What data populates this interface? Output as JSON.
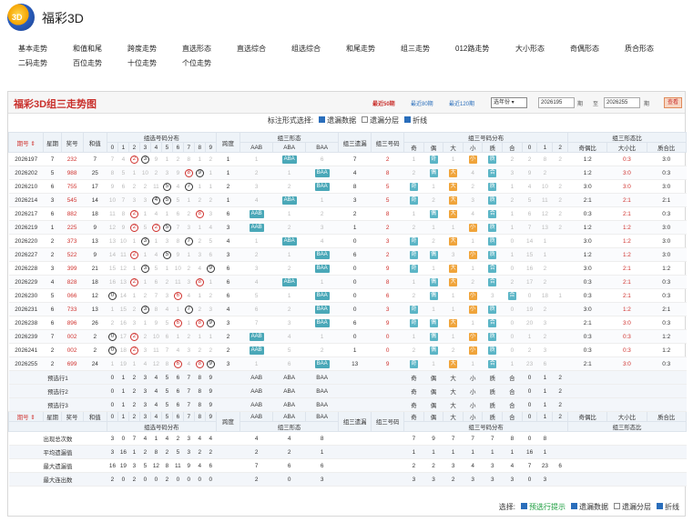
{
  "app": {
    "logo_text": "3D",
    "title": "福彩3D"
  },
  "nav": [
    "基本走势",
    "和值和尾",
    "跨度走势",
    "直选形态",
    "直选综合",
    "组选综合",
    "和尾走势",
    "组三走势",
    "012路走势",
    "大小形态",
    "奇偶形态",
    "质合形态",
    "二码走势",
    "百位走势",
    "十位走势",
    "个位走势"
  ],
  "panel": {
    "title": "福彩3D组三走势图",
    "periods": [
      "最近50期",
      "最近80期",
      "最近120期"
    ],
    "year_select": "选年份",
    "from": "2026195",
    "to_label": "至",
    "to": "2026255",
    "qi": "期",
    "query": "查看",
    "period_label": "期"
  },
  "options": {
    "label": "标注形式选择:",
    "items": [
      {
        "label": "遗漏数据",
        "checked": true
      },
      {
        "label": "遗漏分层",
        "checked": false
      },
      {
        "label": "折线",
        "checked": true
      }
    ]
  },
  "head1": [
    "期号",
    "星期",
    "奖号",
    "和值",
    "组选号码分布",
    "跨度",
    "组三形态",
    "组三遗漏",
    "组三号码",
    "组三号码分布",
    "组三形态比"
  ],
  "head2": [
    "0",
    "1",
    "2",
    "3",
    "4",
    "5",
    "6",
    "7",
    "8",
    "9",
    "AAB",
    "ABA",
    "BAA",
    "奇",
    "偶",
    "大",
    "小",
    "质",
    "合",
    "0",
    "1",
    "2",
    "奇偶比",
    "大小比",
    "质合比"
  ],
  "rows": [
    {
      "q": "2026197",
      "w": "7",
      "n": "232",
      "s": "7",
      "d": [
        "7",
        "4",
        "②",
        "③",
        "9",
        "1",
        "2",
        "8",
        "1",
        "2"
      ],
      "sp": "1",
      "f": [
        "1",
        "ABA",
        "6"
      ],
      "yl": "7",
      "h": "2",
      "g": [
        "1",
        "奇",
        "1",
        "小",
        "质",
        "2",
        "2",
        "8",
        "2"
      ],
      "r": [
        "1:2",
        "0:3",
        "3:0"
      ]
    },
    {
      "q": "2026202",
      "w": "5",
      "n": "988",
      "s": "25",
      "d": [
        "8",
        "5",
        "1",
        "10",
        "2",
        "3",
        "9",
        "⑧",
        "⑨",
        "1"
      ],
      "sp": "1",
      "f": [
        "2",
        "1",
        "BAA"
      ],
      "yl": "4",
      "h": "8",
      "g": [
        "2",
        "偶",
        "大",
        "4",
        "合",
        "3",
        "9",
        "2"
      ],
      "r": [
        "1:2",
        "3:0",
        "0:3"
      ]
    },
    {
      "q": "2026210",
      "w": "6",
      "n": "755",
      "s": "17",
      "d": [
        "9",
        "6",
        "2",
        "2",
        "11",
        "⑤",
        "4",
        "⑦",
        "1",
        "1"
      ],
      "sp": "2",
      "f": [
        "3",
        "2",
        "BAA"
      ],
      "yl": "8",
      "h": "5",
      "g": [
        "奇",
        "1",
        "大",
        "2",
        "质",
        "1",
        "4",
        "10",
        "2"
      ],
      "r": [
        "3:0",
        "3:0",
        "3:0"
      ]
    },
    {
      "q": "2026214",
      "w": "3",
      "n": "545",
      "s": "14",
      "d": [
        "10",
        "7",
        "3",
        "3",
        "④",
        "⑤",
        "5",
        "1",
        "2",
        "2"
      ],
      "sp": "1",
      "f": [
        "4",
        "ABA",
        "1"
      ],
      "yl": "3",
      "h": "5",
      "g": [
        "奇",
        "2",
        "大",
        "3",
        "质",
        "2",
        "5",
        "11",
        "2"
      ],
      "r": [
        "2:1",
        "2:1",
        "2:1"
      ]
    },
    {
      "q": "2026217",
      "w": "6",
      "n": "882",
      "s": "18",
      "d": [
        "11",
        "8",
        "②",
        "1",
        "4",
        "1",
        "6",
        "2",
        "⑧",
        "3"
      ],
      "sp": "6",
      "f": [
        "AAB",
        "1",
        "2"
      ],
      "yl": "2",
      "h": "8",
      "g": [
        "1",
        "偶",
        "大",
        "4",
        "合",
        "1",
        "6",
        "12",
        "2"
      ],
      "r": [
        "0:3",
        "2:1",
        "0:3"
      ]
    },
    {
      "q": "2026219",
      "w": "1",
      "n": "225",
      "s": "9",
      "d": [
        "12",
        "9",
        "②",
        "5",
        "②",
        "⑤",
        "7",
        "3",
        "1",
        "4"
      ],
      "sp": "3",
      "f": [
        "AAB",
        "2",
        "3"
      ],
      "yl": "1",
      "h": "2",
      "g": [
        "2",
        "1",
        "1",
        "小",
        "质",
        "1",
        "7",
        "13",
        "2"
      ],
      "r": [
        "1:2",
        "1:2",
        "3:0"
      ]
    },
    {
      "q": "2026220",
      "w": "2",
      "n": "373",
      "s": "13",
      "d": [
        "13",
        "10",
        "1",
        "③",
        "1",
        "3",
        "8",
        "⑦",
        "2",
        "5"
      ],
      "sp": "4",
      "f": [
        "1",
        "ABA",
        "4"
      ],
      "yl": "0",
      "h": "3",
      "g": [
        "奇",
        "2",
        "大",
        "1",
        "质",
        "0",
        "14",
        "1"
      ],
      "r": [
        "3:0",
        "1:2",
        "3:0"
      ]
    },
    {
      "q": "2026227",
      "w": "2",
      "n": "522",
      "s": "9",
      "d": [
        "14",
        "11",
        "②",
        "1",
        "4",
        "⑤",
        "9",
        "1",
        "3",
        "6"
      ],
      "sp": "3",
      "f": [
        "2",
        "1",
        "BAA"
      ],
      "yl": "6",
      "h": "2",
      "g": [
        "奇",
        "偶",
        "3",
        "小",
        "质",
        "1",
        "15",
        "1"
      ],
      "r": [
        "1:2",
        "1:2",
        "3:0"
      ]
    },
    {
      "q": "2026228",
      "w": "3",
      "n": "399",
      "s": "21",
      "d": [
        "15",
        "12",
        "1",
        "③",
        "5",
        "1",
        "10",
        "2",
        "4",
        "⑨"
      ],
      "sp": "6",
      "f": [
        "3",
        "2",
        "BAA"
      ],
      "yl": "0",
      "h": "9",
      "g": [
        "奇",
        "1",
        "大",
        "1",
        "合",
        "0",
        "16",
        "2"
      ],
      "r": [
        "3:0",
        "2:1",
        "1:2"
      ]
    },
    {
      "q": "2026229",
      "w": "4",
      "n": "828",
      "s": "18",
      "d": [
        "16",
        "13",
        "②",
        "1",
        "6",
        "2",
        "11",
        "3",
        "⑧",
        "1"
      ],
      "sp": "6",
      "f": [
        "4",
        "ABA",
        "1"
      ],
      "yl": "0",
      "h": "8",
      "g": [
        "1",
        "偶",
        "大",
        "2",
        "合",
        "2",
        "17",
        "2"
      ],
      "r": [
        "0:3",
        "2:1",
        "0:3"
      ]
    },
    {
      "q": "2026230",
      "w": "5",
      "n": "066",
      "s": "12",
      "d": [
        "⓪",
        "14",
        "1",
        "2",
        "7",
        "3",
        "⑥",
        "4",
        "1",
        "2"
      ],
      "sp": "6",
      "f": [
        "5",
        "1",
        "BAA"
      ],
      "yl": "0",
      "h": "6",
      "g": [
        "2",
        "偶",
        "1",
        "小",
        "3",
        "合",
        "0",
        "18",
        "1"
      ],
      "r": [
        "0:3",
        "2:1",
        "0:3"
      ]
    },
    {
      "q": "2026231",
      "w": "6",
      "n": "733",
      "s": "13",
      "d": [
        "1",
        "15",
        "2",
        "③",
        "8",
        "4",
        "1",
        "⑦",
        "2",
        "3"
      ],
      "sp": "4",
      "f": [
        "6",
        "2",
        "BAA"
      ],
      "yl": "0",
      "h": "3",
      "g": [
        "奇",
        "1",
        "1",
        "小",
        "质",
        "0",
        "19",
        "2"
      ],
      "r": [
        "3:0",
        "1:2",
        "2:1"
      ]
    },
    {
      "q": "2026238",
      "w": "6",
      "n": "896",
      "s": "26",
      "d": [
        "2",
        "16",
        "3",
        "1",
        "9",
        "5",
        "⑥",
        "1",
        "⑧",
        "⑨"
      ],
      "sp": "3",
      "f": [
        "7",
        "3",
        "BAA"
      ],
      "yl": "6",
      "h": "9",
      "g": [
        "奇",
        "偶",
        "大",
        "1",
        "合",
        "0",
        "20",
        "3"
      ],
      "r": [
        "2:1",
        "3:0",
        "0:3"
      ]
    },
    {
      "q": "2026239",
      "w": "7",
      "n": "002",
      "s": "2",
      "d": [
        "⓪",
        "17",
        "②",
        "2",
        "10",
        "6",
        "1",
        "2",
        "1",
        "1"
      ],
      "sp": "2",
      "f": [
        "AAB",
        "4",
        "1"
      ],
      "yl": "0",
      "h": "0",
      "g": [
        "1",
        "偶",
        "1",
        "小",
        "质",
        "0",
        "1",
        "2"
      ],
      "r": [
        "0:3",
        "0:3",
        "1:2"
      ]
    },
    {
      "q": "2026241",
      "w": "2",
      "n": "002",
      "s": "2",
      "d": [
        "⓪",
        "18",
        "②",
        "3",
        "11",
        "7",
        "4",
        "3",
        "2",
        "2"
      ],
      "sp": "2",
      "f": [
        "AAB",
        "5",
        "2"
      ],
      "yl": "1",
      "h": "0",
      "g": [
        "2",
        "偶",
        "2",
        "小",
        "质",
        "0",
        "2",
        "3"
      ],
      "r": [
        "0:3",
        "0:3",
        "1:2"
      ]
    },
    {
      "q": "2026255",
      "w": "2",
      "n": "699",
      "s": "24",
      "d": [
        "1",
        "19",
        "1",
        "4",
        "12",
        "8",
        "⑥",
        "4",
        "⑧",
        "⑨"
      ],
      "sp": "3",
      "f": [
        "1",
        "6",
        "BAA"
      ],
      "yl": "13",
      "h": "9",
      "g": [
        "奇",
        "1",
        "大",
        "1",
        "合",
        "1",
        "23",
        "6"
      ],
      "r": [
        "2:1",
        "3:0",
        "0:3"
      ]
    }
  ],
  "preview": [
    "预选行1",
    "预选行2",
    "预选行3"
  ],
  "foot_labels": {
    "grp": "组选号码分布",
    "yl": "组三遗漏",
    "hm": "组三号码",
    "xt": "组三形态",
    "fb": "组三号码分布",
    "bi": "组三形态比"
  },
  "stats": [
    {
      "label": "出现总次数",
      "d": [
        "3",
        "0",
        "7",
        "4",
        "1",
        "4",
        "2",
        "3",
        "4",
        "4"
      ],
      "f": [
        "4",
        "4",
        "8"
      ],
      "g": [
        "7",
        "9",
        "7",
        "7",
        "7",
        "8",
        "0",
        "8"
      ]
    },
    {
      "label": "平均遗漏值",
      "d": [
        "3",
        "16",
        "1",
        "2",
        "8",
        "2",
        "5",
        "3",
        "2",
        "2"
      ],
      "f": [
        "2",
        "2",
        "1"
      ],
      "g": [
        "1",
        "1",
        "1",
        "1",
        "1",
        "1",
        "16",
        "1"
      ]
    },
    {
      "label": "最大遗漏值",
      "d": [
        "16",
        "19",
        "3",
        "5",
        "12",
        "8",
        "11",
        "9",
        "4",
        "6"
      ],
      "f": [
        "7",
        "6",
        "6"
      ],
      "g": [
        "2",
        "2",
        "3",
        "4",
        "3",
        "4",
        "7",
        "23",
        "6"
      ]
    },
    {
      "label": "最大连出数",
      "d": [
        "2",
        "0",
        "2",
        "0",
        "0",
        "2",
        "0",
        "0",
        "0",
        "0"
      ],
      "f": [
        "2",
        "0",
        "3"
      ],
      "g": [
        "3",
        "3",
        "2",
        "3",
        "3",
        "3",
        "0",
        "3"
      ]
    }
  ],
  "bottom": {
    "label": "选择:",
    "items": [
      {
        "label": "预选行提示",
        "checked": true
      },
      {
        "label": "遗漏数据",
        "checked": true
      },
      {
        "label": "遗漏分层",
        "checked": false
      },
      {
        "label": "折线",
        "checked": true
      }
    ]
  }
}
